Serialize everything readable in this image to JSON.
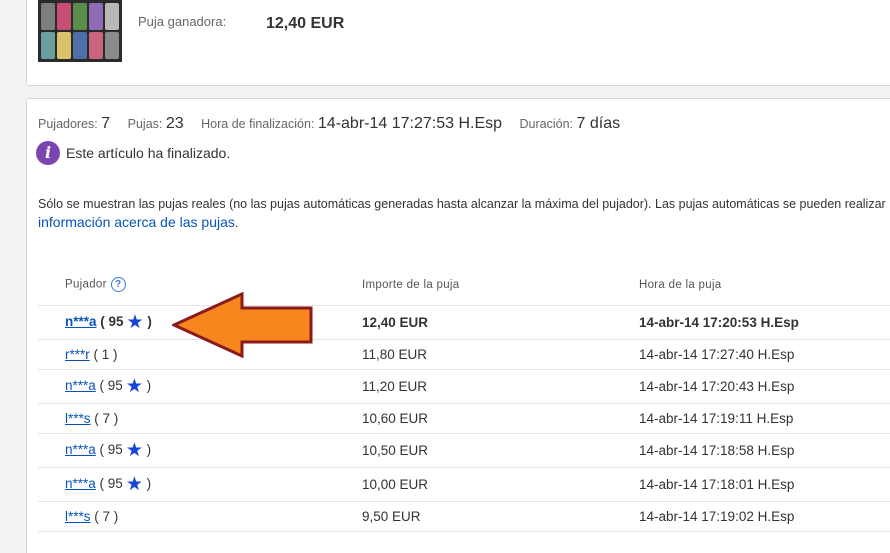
{
  "item": {
    "winning_bid_label": "Puja ganadora:",
    "winning_bid_value": "12,40 EUR"
  },
  "stats": {
    "bidders_label": "Pujadores:",
    "bidders_value": "7",
    "bids_label": "Pujas:",
    "bids_value": "23",
    "end_time_label": "Hora de finalización:",
    "end_time_value": "14-abr-14 17:27:53 H.Esp",
    "duration_label": "Duración:",
    "duration_value": "7 días"
  },
  "status": {
    "icon": "info-icon",
    "text": "Este artículo ha finalizado."
  },
  "notice": {
    "text": "Sólo se muestran las pujas reales (no las pujas automáticas generadas hasta alcanzar la máxima del pujador). Las pujas automáticas se pueden realizar",
    "link": "información acerca de las pujas",
    "link_suffix": "."
  },
  "table": {
    "headers": {
      "bidder": "Pujador",
      "amount": "Importe de la puja",
      "time": "Hora de la puja"
    },
    "help_icon": "?",
    "rows": [
      {
        "name": "n***a",
        "score": "( 95",
        "close": ")",
        "star": true,
        "amount": "12,40 EUR",
        "time": "14-abr-14 17:20:53 H.Esp"
      },
      {
        "name": "r***r",
        "score": "( 1 )",
        "close": "",
        "star": false,
        "amount": "11,80 EUR",
        "time": "14-abr-14 17:27:40 H.Esp"
      },
      {
        "name": "n***a",
        "score": "( 95",
        "close": ")",
        "star": true,
        "amount": "11,20 EUR",
        "time": "14-abr-14 17:20:43 H.Esp"
      },
      {
        "name": "l***s",
        "score": "( 7 )",
        "close": "",
        "star": false,
        "amount": "10,60 EUR",
        "time": "14-abr-14 17:19:11 H.Esp"
      },
      {
        "name": "n***a",
        "score": "( 95",
        "close": ")",
        "star": true,
        "amount": "10,50 EUR",
        "time": "14-abr-14 17:18:58 H.Esp"
      },
      {
        "name": "n***a",
        "score": "( 95",
        "close": ")",
        "star": true,
        "amount": "10,00 EUR",
        "time": "14-abr-14 17:18:01 H.Esp"
      },
      {
        "name": "l***s",
        "score": "( 7 )",
        "close": "",
        "star": false,
        "amount": "9,50 EUR",
        "time": "14-abr-14 17:19:02 H.Esp"
      }
    ]
  },
  "colors": {
    "link": "#0654ba",
    "star": "#1746d4",
    "info": "#7a45b0",
    "arrow_fill": "#f7861e",
    "arrow_stroke": "#8b1a1a"
  }
}
